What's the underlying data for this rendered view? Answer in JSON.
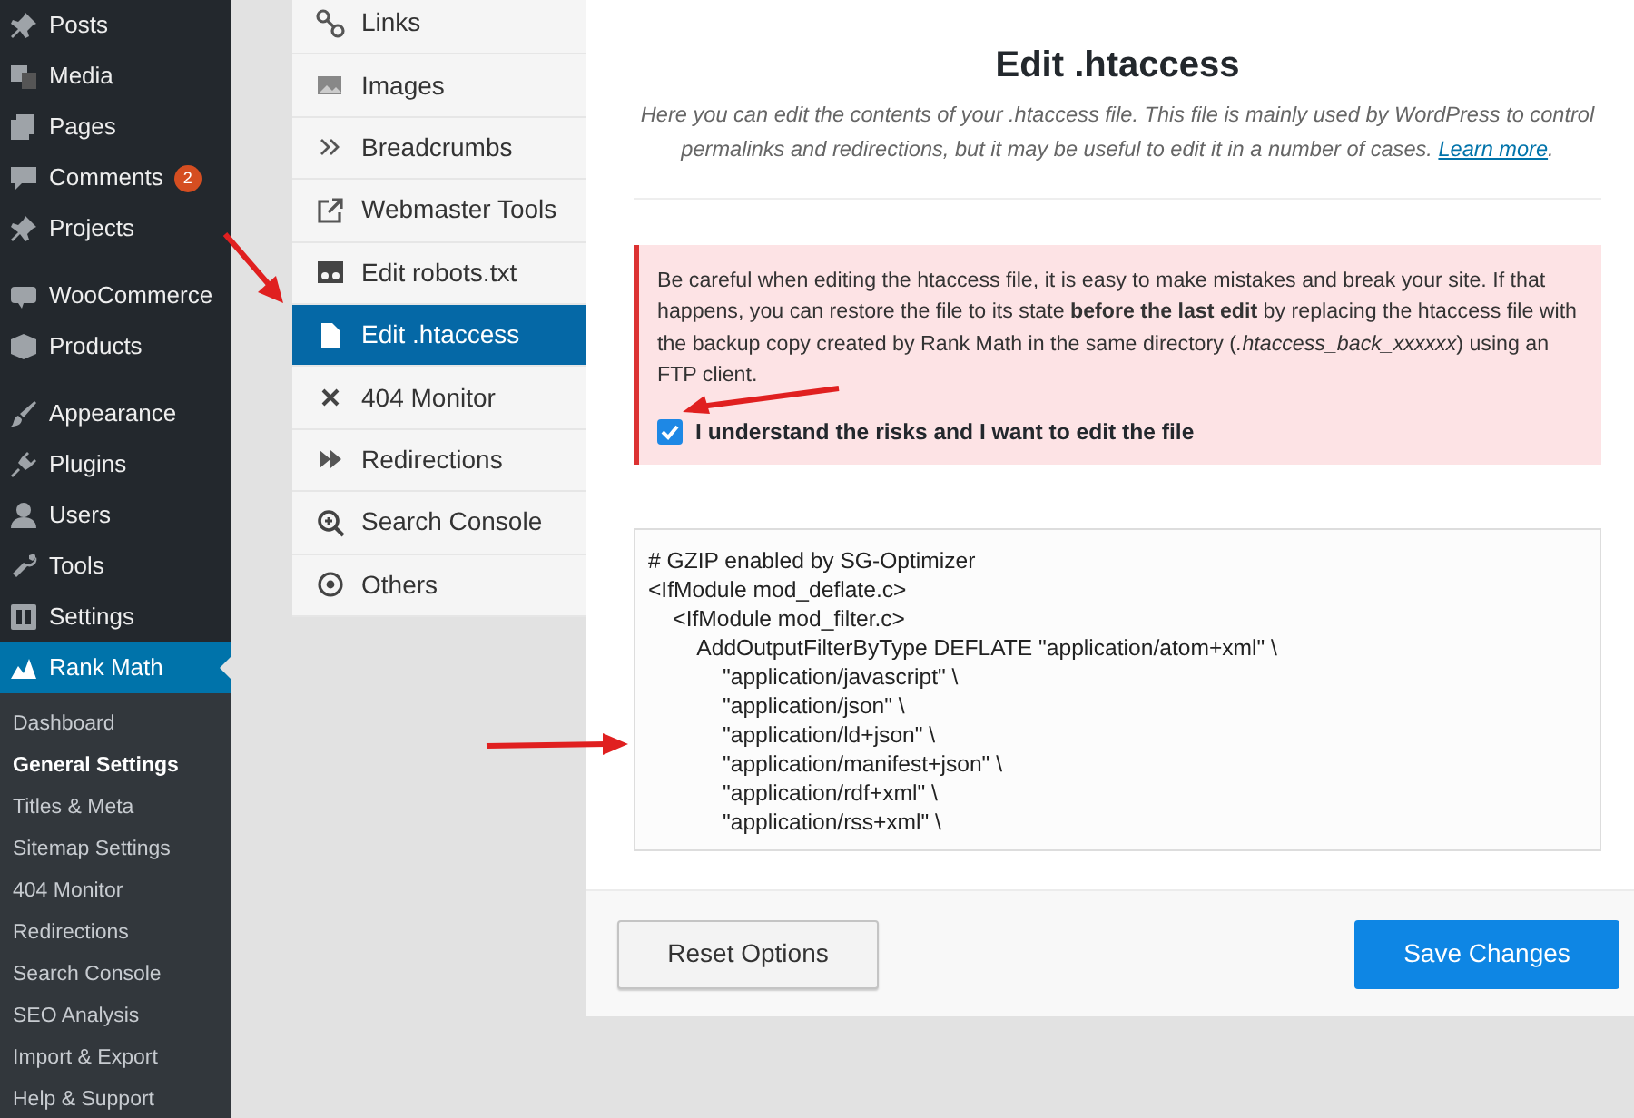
{
  "admin_menu": [
    {
      "items": [
        {
          "label": "Posts",
          "selected": false
        },
        {
          "label": "Media",
          "selected": false
        },
        {
          "label": "Pages",
          "selected": false
        },
        {
          "label": "Comments",
          "badge": "2",
          "selected": false
        },
        {
          "label": "Projects",
          "selected": false
        }
      ]
    },
    {
      "items": [
        {
          "label": "WooCommerce",
          "selected": false
        },
        {
          "label": "Products",
          "selected": false
        }
      ]
    },
    {
      "items": [
        {
          "label": "Appearance",
          "selected": false
        },
        {
          "label": "Plugins",
          "selected": false
        },
        {
          "label": "Users",
          "selected": false
        },
        {
          "label": "Tools",
          "selected": false
        },
        {
          "label": "Settings",
          "selected": false
        },
        {
          "label": "Rank Math",
          "selected": true
        }
      ]
    }
  ],
  "submenu": [
    {
      "label": "Dashboard",
      "selected": false
    },
    {
      "label": "General Settings",
      "selected": true
    },
    {
      "label": "Titles & Meta",
      "selected": false
    },
    {
      "label": "Sitemap Settings",
      "selected": false
    },
    {
      "label": "404 Monitor",
      "selected": false
    },
    {
      "label": "Redirections",
      "selected": false
    },
    {
      "label": "Search Console",
      "selected": false
    },
    {
      "label": "SEO Analysis",
      "selected": false
    },
    {
      "label": "Import & Export",
      "selected": false
    },
    {
      "label": "Help & Support",
      "selected": false
    }
  ],
  "settings_tabs": [
    {
      "label": "Links",
      "selected": false
    },
    {
      "label": "Images",
      "selected": false
    },
    {
      "label": "Breadcrumbs",
      "selected": false
    },
    {
      "label": "Webmaster Tools",
      "selected": false
    },
    {
      "label": "Edit robots.txt",
      "selected": false
    },
    {
      "label": "Edit .htaccess",
      "selected": true
    },
    {
      "label": "404 Monitor",
      "selected": false
    },
    {
      "label": "Redirections",
      "selected": false
    },
    {
      "label": "Search Console",
      "selected": false
    },
    {
      "label": "Others",
      "selected": false
    }
  ],
  "panel": {
    "title": "Edit .htaccess",
    "description": "Here you can edit the contents of your .htaccess file. This file is mainly used by WordPress to control permalinks and redirections, but it may be useful to edit it in a number of cases.",
    "learn_more": "Learn more",
    "after_link": ".",
    "warning": "Be careful when editing the htaccess file, it is easy to make mistakes and break your site. If that happens, you can restore the file to its state **before the last edit** by replacing the htaccess file with the backup copy created by Rank Math in the same directory (*.htaccess_back_xxxxxx*) using an FTP client.",
    "confirm": {
      "label": "I understand the risks and I want to edit the file",
      "checked": true
    },
    "code_lines": [
      "# GZIP enabled by SG-Optimizer",
      "<IfModule mod_deflate.c>",
      "    <IfModule mod_filter.c>",
      "        AddOutputFilterByType DEFLATE \"application/atom+xml\" \\",
      "            \"application/javascript\" \\",
      "            \"application/json\" \\",
      "            \"application/ld+json\" \\",
      "            \"application/manifest+json\" \\",
      "            \"application/rdf+xml\" \\",
      "            \"application/rss+xml\" \\"
    ]
  },
  "footer": {
    "reset": "Reset Options",
    "save": "Save Changes"
  }
}
